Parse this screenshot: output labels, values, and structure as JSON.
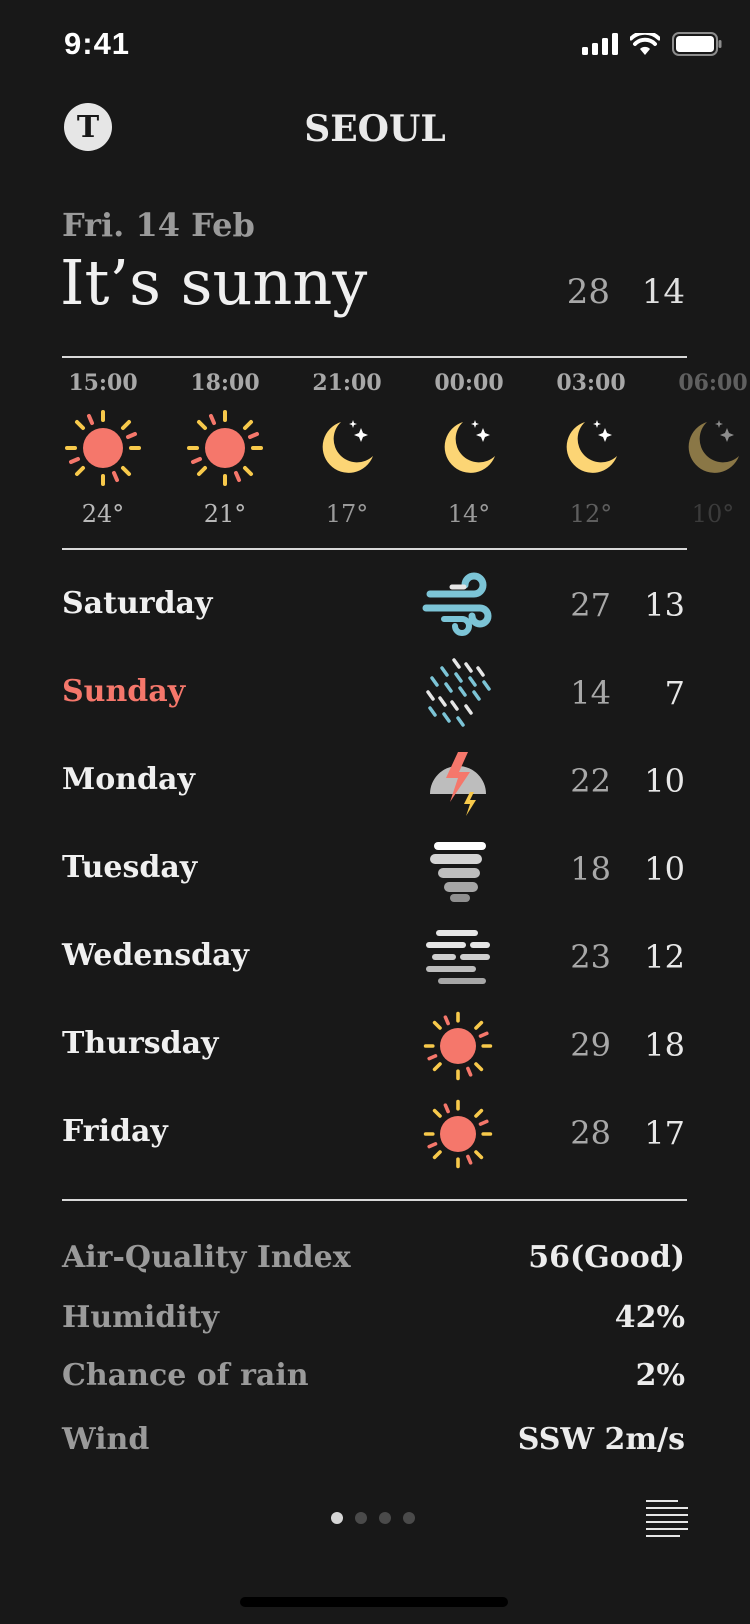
{
  "status": {
    "time": "9:41"
  },
  "header": {
    "avatar_letter": "T",
    "city": "SEOUL"
  },
  "today": {
    "date": "Fri. 14 Feb",
    "condition": "It’s sunny",
    "high": "28",
    "low": "14"
  },
  "hourly": [
    {
      "time": "15:00",
      "icon": "sun-icon",
      "temp": "24°"
    },
    {
      "time": "18:00",
      "icon": "sun-icon",
      "temp": "21°"
    },
    {
      "time": "21:00",
      "icon": "moon-icon",
      "temp": "17°"
    },
    {
      "time": "00:00",
      "icon": "moon-icon",
      "temp": "14°"
    },
    {
      "time": "03:00",
      "icon": "moon-icon",
      "temp": "12°"
    },
    {
      "time": "06:00",
      "icon": "moon-icon",
      "temp": "10°"
    }
  ],
  "daily": [
    {
      "day": "Saturday",
      "icon": "wind-icon",
      "high": "27",
      "low": "13"
    },
    {
      "day": "Sunday",
      "icon": "rain-icon",
      "high": "14",
      "low": "7"
    },
    {
      "day": "Monday",
      "icon": "thunderstorm-icon",
      "high": "22",
      "low": "10"
    },
    {
      "day": "Tuesday",
      "icon": "tornado-icon",
      "high": "18",
      "low": "10"
    },
    {
      "day": "Wedensday",
      "icon": "fog-icon",
      "high": "23",
      "low": "12"
    },
    {
      "day": "Thursday",
      "icon": "sun-icon",
      "high": "29",
      "low": "18"
    },
    {
      "day": "Friday",
      "icon": "sun-icon",
      "high": "28",
      "low": "17"
    }
  ],
  "details": [
    {
      "label": "Air-Quality Index",
      "value": "56(Good)"
    },
    {
      "label": "Humidity",
      "value": "42%"
    },
    {
      "label": "Chance of rain",
      "value": "2%"
    },
    {
      "label": "Wind",
      "value": "SSW 2m/s"
    }
  ],
  "pager": {
    "count": 4,
    "active": 0
  },
  "colors": {
    "background": "#181818",
    "sun": "#f5776b",
    "sun_rays": "#f7c94b",
    "moon": "#fcd575",
    "weekend": "#f5776b",
    "wind": "#7cc4d6"
  }
}
